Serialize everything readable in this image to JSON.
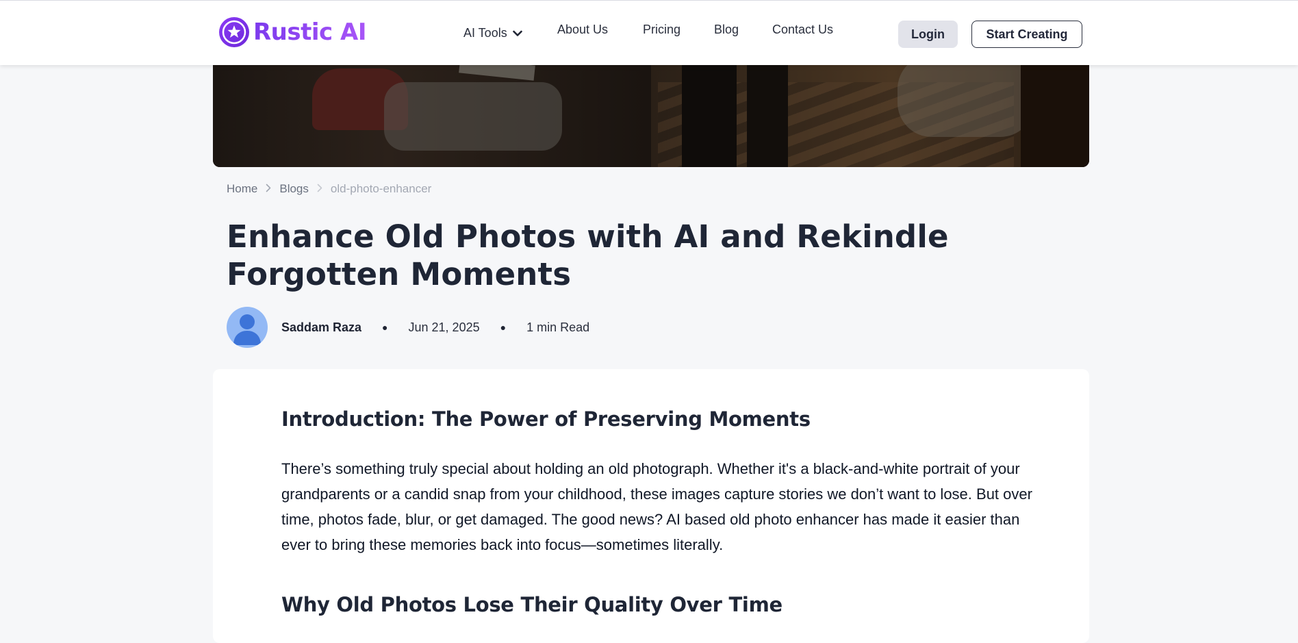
{
  "header": {
    "logo_text": "Rustic AI",
    "nav": [
      {
        "label": "AI Tools",
        "has_dropdown": true
      },
      {
        "label": "About Us"
      },
      {
        "label": "Pricing"
      },
      {
        "label": "Blog"
      },
      {
        "label": "Contact Us"
      }
    ],
    "login_label": "Login",
    "start_label": "Start Creating"
  },
  "breadcrumb": [
    "Home",
    "Blogs",
    "old-photo-enhancer"
  ],
  "article": {
    "title": "Enhance Old Photos with AI and Rekindle Forgotten Moments",
    "author": "Saddam Raza",
    "date": "Jun 21, 2025",
    "read_time": "1 min Read",
    "sections": [
      {
        "heading": "Introduction: The Power of Preserving Moments",
        "body": "There’s something truly special about holding an old photograph. Whether it's a black-and-white portrait of your grandparents or a candid snap from your childhood, these images capture stories we don’t want to lose. But over time, photos fade, blur, or get damaged. The good news? AI based old photo enhancer has made it easier than ever to bring these memories back into focus—sometimes literally."
      },
      {
        "heading": "Why Old Photos Lose Their Quality Over Time"
      }
    ]
  },
  "colors": {
    "brand_purple": "#7c3aed",
    "page_bg": "#f6f7f9",
    "avatar_bg": "#93b9f5",
    "avatar_figure": "#3d74d8"
  }
}
